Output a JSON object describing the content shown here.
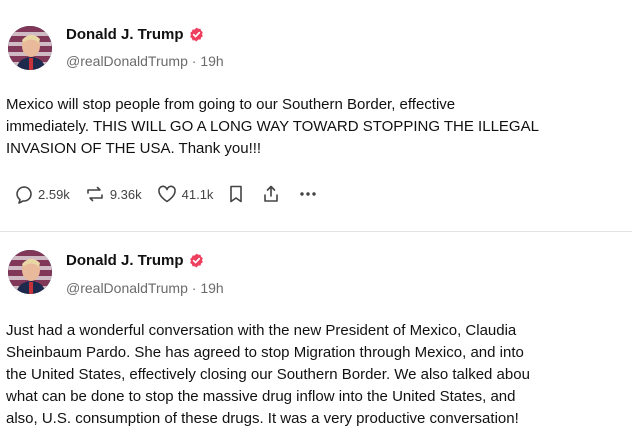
{
  "posts": [
    {
      "author": "Donald J. Trump",
      "handle": "@realDonaldTrump",
      "sep": "·",
      "time": "19h",
      "lines": [
        "Mexico will stop people from going to our Southern Border, effective",
        "immediately. THIS WILL GO A LONG WAY TOWARD STOPPING THE ILLEGAL",
        "INVASION OF THE USA. Thank you!!!"
      ],
      "replies": "2.59k",
      "reposts": "9.36k",
      "likes": "41.1k"
    },
    {
      "author": "Donald J. Trump",
      "handle": "@realDonaldTrump",
      "sep": "·",
      "time": "19h",
      "lines": [
        "Just had a wonderful conversation with the new President of Mexico, Claudia",
        "Sheinbaum Pardo. She has agreed to stop Migration through Mexico, and into",
        "the United States, effectively closing our Southern Border. We also talked abou",
        "what can be done to stop the massive drug inflow into the United States, and",
        "also, U.S. consumption of these drugs. It was a very productive conversation!"
      ]
    }
  ],
  "colors": {
    "verified": "#ee3f5f",
    "muted": "#6b6b6b",
    "divider": "#e3e3e3"
  },
  "icons": [
    "verified-badge-icon",
    "reply-icon",
    "repost-icon",
    "like-icon",
    "bookmark-icon",
    "share-icon",
    "more-icon"
  ]
}
